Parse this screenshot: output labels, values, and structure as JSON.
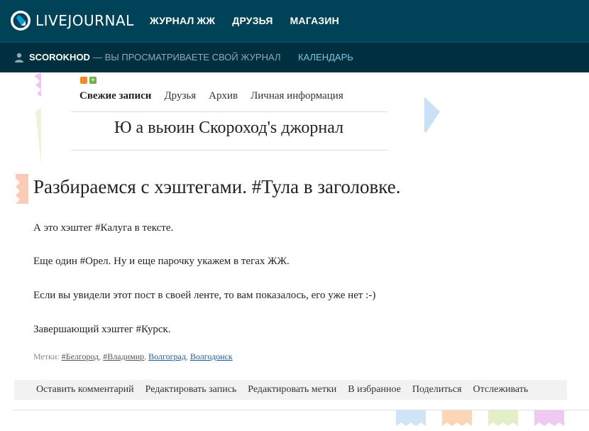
{
  "brand": {
    "logo_text": "LIVEJOURNAL"
  },
  "topnav": {
    "items": [
      "ЖУРНАЛ ЖЖ",
      "ДРУЗЬЯ",
      "МАГАЗИН"
    ]
  },
  "subbar": {
    "username": "SCOROKHOD",
    "note": "— ВЫ ПРОСМАТРИВАЕТЕ СВОЙ ЖУРНАЛ",
    "calendar": "КАЛЕНДАРЬ"
  },
  "journal": {
    "nav": [
      "Свежие записи",
      "Друзья",
      "Архив",
      "Личная информация"
    ],
    "title": "Ю а вьюин Скороход's джорнал"
  },
  "post": {
    "title": "Разбираемся с хэштегами. #Тула в заголовке.",
    "paragraphs": [
      "А это хэштег #Калуга в тексте.",
      "Еще один #Орел. Ну и еще парочку укажем в тегах ЖЖ.",
      "Если вы увидели этот пост в своей ленте, то вам показалось, его уже нет :-)",
      "Завершающий хэштег #Курск."
    ],
    "tags_label": "Метки:",
    "tags": [
      "#Белгород",
      "#Владимир",
      "Волгоград",
      "Волгодонск"
    ]
  },
  "actions": [
    "Оставить комментарий",
    "Редактировать запись",
    "Редактировать метки",
    "В избранное",
    "Поделиться",
    "Отслеживать"
  ],
  "colors": {
    "topbar": "#004359",
    "subbar": "#002f3f",
    "link_blue": "#1a58a8",
    "calendar": "#79c7e0"
  }
}
